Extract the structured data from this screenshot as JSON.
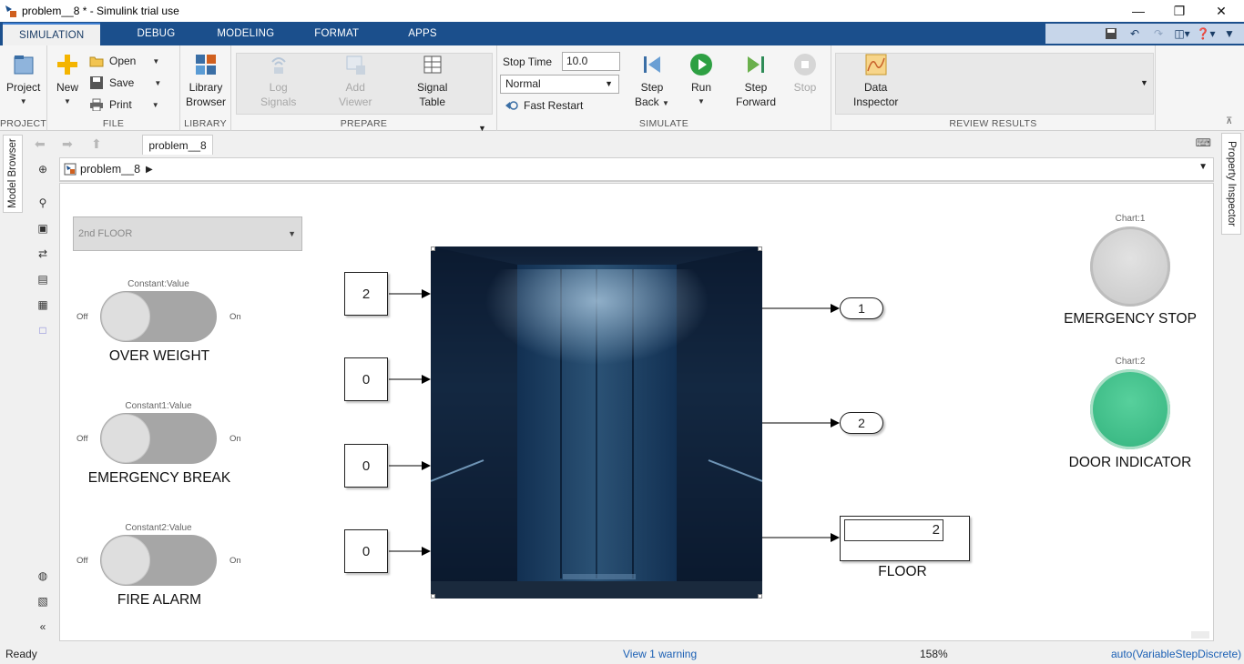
{
  "window": {
    "title": "problem__8 * - Simulink trial use",
    "controls": [
      "minimize",
      "maximize",
      "close"
    ]
  },
  "ribbon": {
    "tabs": [
      "SIMULATION",
      "DEBUG",
      "MODELING",
      "FORMAT",
      "APPS"
    ],
    "active_tab": "SIMULATION",
    "groups": {
      "project": {
        "label": "PROJECT",
        "project_btn": "Project"
      },
      "file": {
        "label": "FILE",
        "new_btn": "New",
        "open_btn": "Open",
        "save_btn": "Save",
        "print_btn": "Print"
      },
      "library": {
        "label": "LIBRARY",
        "library_btn_1": "Library",
        "library_btn_2": "Browser"
      },
      "prepare": {
        "label": "PREPARE",
        "log_1": "Log",
        "log_2": "Signals",
        "add_1": "Add",
        "add_2": "Viewer",
        "signal_1": "Signal",
        "signal_2": "Table"
      },
      "simulate": {
        "label": "SIMULATE",
        "stop_time_label": "Stop Time",
        "stop_time_value": "10.0",
        "mode_value": "Normal",
        "fast_restart": "Fast Restart",
        "step_back_1": "Step",
        "step_back_2": "Back",
        "run": "Run",
        "step_forward_1": "Step",
        "step_forward_2": "Forward",
        "stop": "Stop"
      },
      "review": {
        "label": "REVIEW RESULTS",
        "data_1": "Data",
        "data_2": "Inspector"
      }
    }
  },
  "left_panel": {
    "model_browser_tab": "Model Browser"
  },
  "right_panel": {
    "property_inspector_tab": "Property Inspector"
  },
  "nav": {
    "doc_tab": "problem__8",
    "breadcrumb": "problem__8"
  },
  "canvas": {
    "floor_dropdown": "2nd FLOOR",
    "switches": [
      {
        "caption": "Constant:Value",
        "off": "Off",
        "on": "On",
        "label": "OVER WEIGHT"
      },
      {
        "caption": "Constant1:Value",
        "off": "Off",
        "on": "On",
        "label": "EMERGENCY BREAK"
      },
      {
        "caption": "Constant2:Value",
        "off": "Off",
        "on": "On",
        "label": "FIRE ALARM"
      }
    ],
    "constants": [
      "2",
      "0",
      "0",
      "0"
    ],
    "outports": [
      "1",
      "2"
    ],
    "display": {
      "value": "2",
      "label": "FLOOR"
    },
    "lamps": [
      {
        "caption": "Chart:1",
        "label": "EMERGENCY STOP",
        "color": "#d3d3d3"
      },
      {
        "caption": "Chart:2",
        "label": "DOOR INDICATOR",
        "color": "#3dbb86"
      }
    ]
  },
  "status": {
    "left": "Ready",
    "warning": "View 1 warning",
    "zoom": "158%",
    "solver": "auto(VariableStepDiscrete)"
  },
  "colors": {
    "ribbon_blue": "#1b4f8c",
    "link_blue": "#1a5fb4",
    "run_green": "#2ea043",
    "lamp_off": "#d3d3d3",
    "lamp_on": "#3dbb86"
  }
}
